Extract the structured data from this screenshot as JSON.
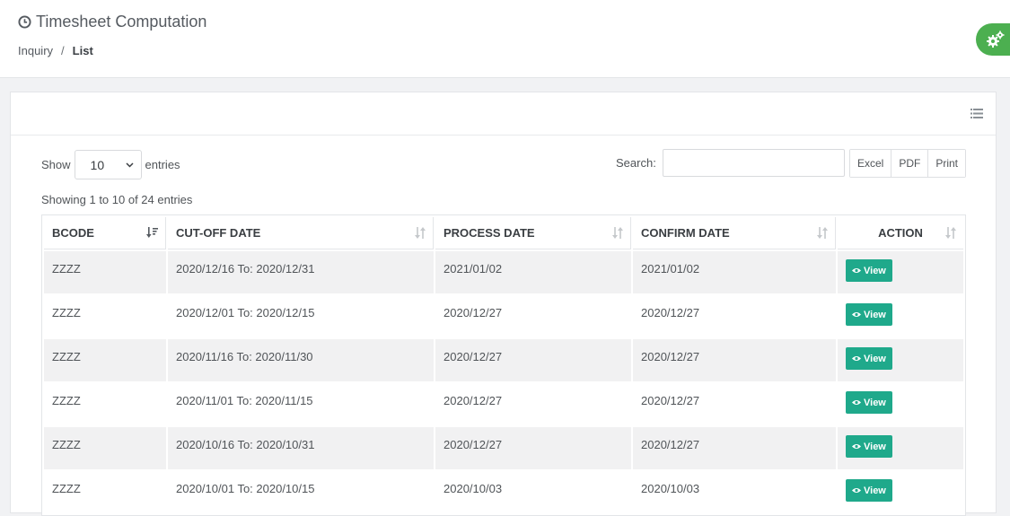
{
  "header": {
    "title": "Timesheet Computation",
    "breadcrumb": [
      "Inquiry",
      "/",
      "List"
    ]
  },
  "controls": {
    "show_label": "Show",
    "page_length": "10",
    "entries_label": "entries",
    "search_label": "Search:",
    "search_value": "",
    "export_buttons": [
      "Excel",
      "PDF",
      "Print"
    ]
  },
  "info": "Showing 1 to 10 of 24 entries",
  "table": {
    "columns": [
      "BCODE",
      "CUT-OFF DATE",
      "PROCESS DATE",
      "CONFIRM DATE",
      "ACTION"
    ],
    "rows": [
      {
        "bcode": "ZZZZ",
        "cutoff": "2020/12/16 To: 2020/12/31",
        "process": "2021/01/02",
        "confirm": "2021/01/02",
        "action": "View"
      },
      {
        "bcode": "ZZZZ",
        "cutoff": "2020/12/01 To: 2020/12/15",
        "process": "2020/12/27",
        "confirm": "2020/12/27",
        "action": "View"
      },
      {
        "bcode": "ZZZZ",
        "cutoff": "2020/11/16 To: 2020/11/30",
        "process": "2020/12/27",
        "confirm": "2020/12/27",
        "action": "View"
      },
      {
        "bcode": "ZZZZ",
        "cutoff": "2020/11/01 To: 2020/11/15",
        "process": "2020/12/27",
        "confirm": "2020/12/27",
        "action": "View"
      },
      {
        "bcode": "ZZZZ",
        "cutoff": "2020/10/16 To: 2020/10/31",
        "process": "2020/12/27",
        "confirm": "2020/12/27",
        "action": "View"
      },
      {
        "bcode": "ZZZZ",
        "cutoff": "2020/10/01 To: 2020/10/15",
        "process": "2020/10/03",
        "confirm": "2020/10/03",
        "action": "View"
      }
    ]
  },
  "icons": {
    "title": "clock-icon",
    "fab": "gears-icon",
    "card_menu": "list-icon",
    "sort_active": "sort-desc-icon",
    "sort": "sort-icon",
    "view": "eye-icon"
  },
  "colors": {
    "accent": "#1fa98b",
    "fab": "#4caf50",
    "row_alt": "#f1f1f2"
  }
}
